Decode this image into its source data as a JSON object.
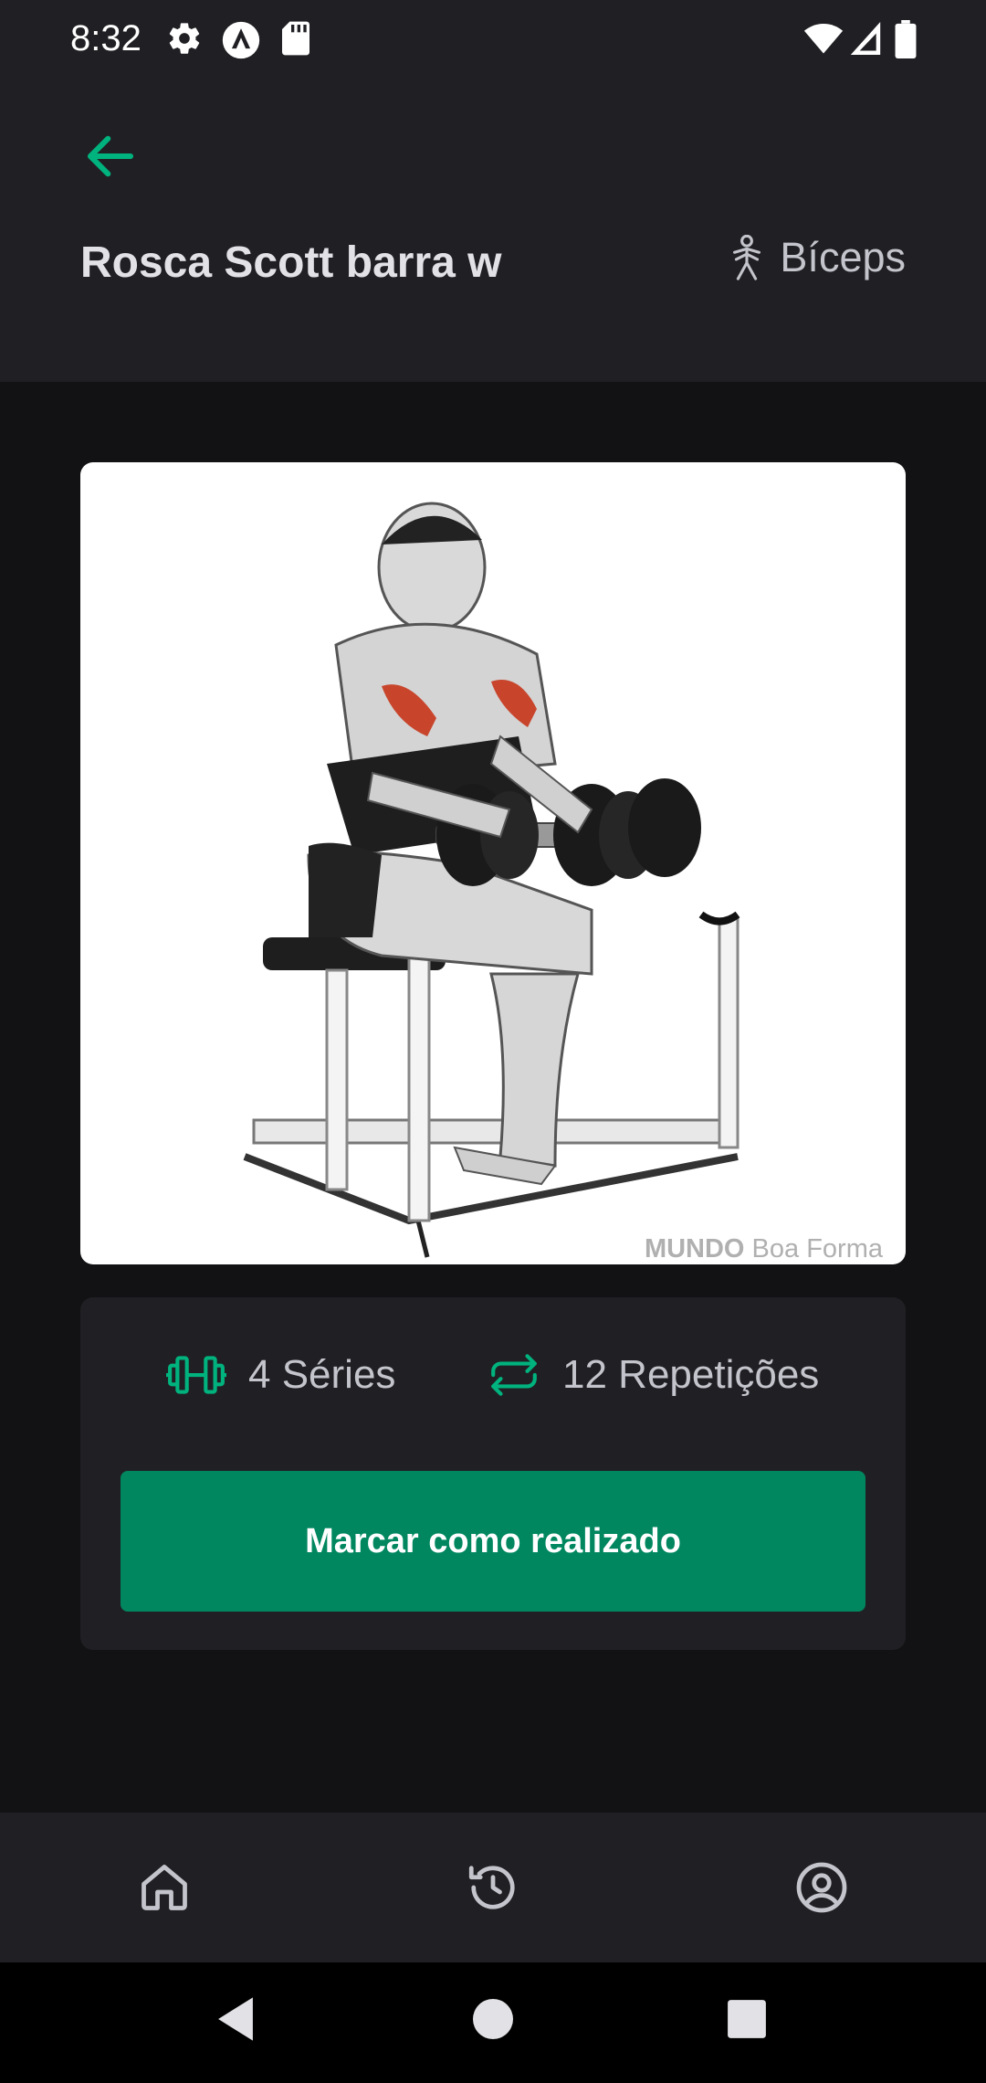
{
  "status_bar": {
    "time": "8:32"
  },
  "header": {
    "title": "Rosca Scott barra w",
    "group": "Bíceps"
  },
  "image": {
    "watermark_bold": "MUNDO",
    "watermark_light": "Boa Forma"
  },
  "stats": {
    "series": "4 Séries",
    "repetitions": "12 Repetições"
  },
  "actions": {
    "mark_done": "Marcar como realizado"
  },
  "colors": {
    "accent": "#00875f",
    "accent_light": "#00b37e",
    "background": "#121214",
    "surface": "#202024"
  },
  "icons": {
    "back": "arrow-left-icon",
    "group": "body-icon",
    "series": "dumbbell-icon",
    "repetitions": "repeat-icon",
    "nav_home": "home-icon",
    "nav_history": "history-icon",
    "nav_profile": "user-circle-icon"
  }
}
